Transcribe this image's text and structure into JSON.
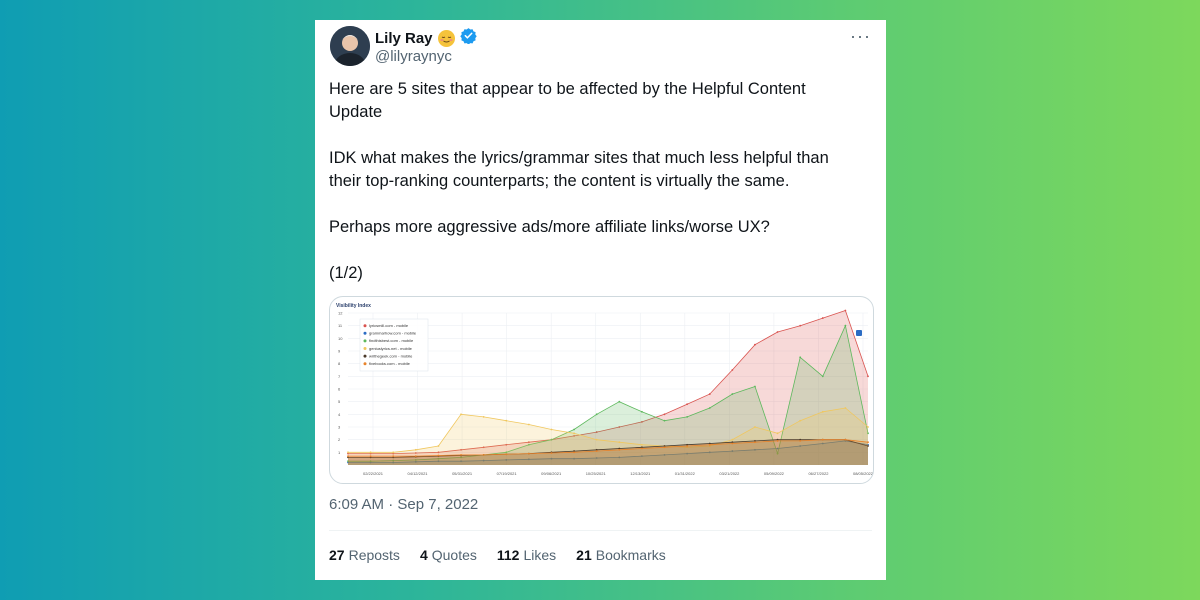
{
  "tweet": {
    "author_name": "Lily Ray",
    "author_emoji": "😌",
    "handle": "@lilyraynyc",
    "paragraphs": [
      "Here are 5 sites that appear to be affected by the Helpful Content Update",
      "IDK what makes the lyrics/grammar sites that much less helpful than their top-ranking counterparts; the content is virtually the same.",
      "Perhaps more aggressive ads/more affiliate links/worse UX?",
      "(1/2)"
    ],
    "timestamp": "6:09 AM · Sep 7, 2022",
    "stats": [
      {
        "count": "27",
        "label": "Reposts"
      },
      {
        "count": "4",
        "label": "Quotes"
      },
      {
        "count": "112",
        "label": "Likes"
      },
      {
        "count": "21",
        "label": "Bookmarks"
      }
    ],
    "icons": {
      "verified": "verified-badge-icon",
      "more": "more-options-icon"
    }
  },
  "chart_data": {
    "type": "area",
    "title": "Visibility Index",
    "y_ticks": [
      "1",
      "2",
      "3",
      "4",
      "5",
      "6",
      "7",
      "8",
      "9",
      "10",
      "11",
      "12"
    ],
    "ylim": [
      0,
      12
    ],
    "x_ticks": [
      "02/22/2021",
      "04/12/2021",
      "05/31/2021",
      "07/19/2021",
      "09/06/2021",
      "10/25/2021",
      "12/13/2021",
      "01/31/2022",
      "03/21/2022",
      "05/09/2022",
      "06/27/2022",
      "08/05/2022"
    ],
    "grid": true,
    "legend_position": "top-left",
    "series": [
      {
        "name": "lyricsmill.com - mobile",
        "color": "#d9534f",
        "values": [
          0.9,
          0.9,
          0.9,
          0.95,
          1.0,
          1.2,
          1.4,
          1.6,
          1.8,
          2.0,
          2.3,
          2.6,
          3.0,
          3.4,
          4.0,
          4.8,
          5.6,
          7.5,
          9.5,
          10.5,
          11.0,
          11.6,
          12.2,
          7.0
        ]
      },
      {
        "name": "grammarhow.com - mobile",
        "color": "#2b6cc4",
        "values": [
          0.2,
          0.2,
          0.2,
          0.25,
          0.3,
          0.3,
          0.35,
          0.4,
          0.45,
          0.5,
          0.5,
          0.55,
          0.6,
          0.7,
          0.8,
          0.9,
          1.0,
          1.1,
          1.2,
          1.3,
          1.5,
          1.7,
          1.9,
          1.6
        ]
      },
      {
        "name": "findthisbest.com - mobile",
        "color": "#5cb85c",
        "values": [
          0.3,
          0.3,
          0.35,
          0.4,
          0.5,
          0.6,
          0.8,
          1.0,
          1.6,
          2.0,
          2.8,
          4.0,
          5.0,
          4.2,
          3.5,
          3.8,
          4.5,
          5.6,
          6.2,
          0.9,
          8.5,
          7.0,
          11.0,
          2.5
        ]
      },
      {
        "name": "geniuslyrics.net - mobile",
        "color": "#f0c75e",
        "values": [
          1.0,
          1.0,
          1.0,
          1.2,
          1.5,
          4.0,
          3.8,
          3.5,
          3.2,
          2.8,
          2.5,
          2.0,
          1.8,
          1.6,
          1.5,
          1.4,
          1.5,
          2.0,
          3.0,
          2.5,
          3.5,
          4.2,
          4.5,
          3.0
        ]
      },
      {
        "name": "writhegeek.com - mobile",
        "color": "#4a3a2a",
        "values": [
          0.6,
          0.6,
          0.6,
          0.65,
          0.7,
          0.75,
          0.8,
          0.85,
          0.9,
          1.0,
          1.1,
          1.2,
          1.3,
          1.4,
          1.5,
          1.6,
          1.7,
          1.8,
          1.9,
          2.0,
          2.0,
          2.0,
          2.0,
          1.5
        ]
      },
      {
        "name": "fivebooks.com - mobile",
        "color": "#e8832b",
        "values": [
          0.7,
          0.7,
          0.7,
          0.7,
          0.75,
          0.8,
          0.8,
          0.85,
          0.9,
          0.95,
          1.0,
          1.1,
          1.2,
          1.3,
          1.4,
          1.5,
          1.6,
          1.7,
          1.8,
          1.9,
          1.9,
          2.0,
          2.0,
          1.8
        ]
      }
    ]
  }
}
